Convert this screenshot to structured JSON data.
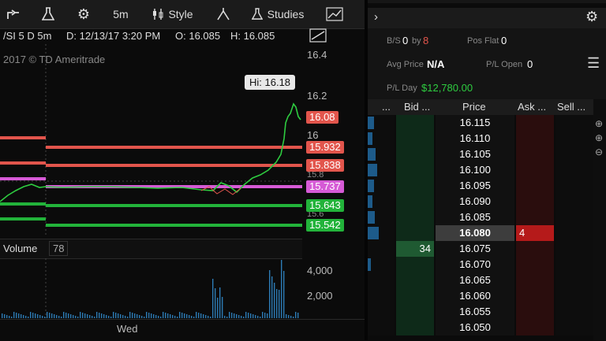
{
  "toolbar": {
    "timeframe": "5m",
    "style_label": "Style",
    "studies_label": "Studies"
  },
  "chart_header": {
    "symbol": "/SI 5 D 5m",
    "date": "D: 12/13/17 3:20 PM",
    "open": "O: 16.085",
    "high": "H: 16.085",
    "copyright": "2017 © TD Ameritrade"
  },
  "chart": {
    "hi_label": "Hi: 16.18",
    "y_ticks": [
      "16.4",
      "16.2",
      "16",
      "15.8",
      "15.6"
    ],
    "x_label": "Wed",
    "price_levels": [
      {
        "value": "16.08",
        "color": "#e2554c"
      },
      {
        "value": "15.932",
        "color": "#e2554c"
      },
      {
        "value": "15.838",
        "color": "#e2554c"
      },
      {
        "value": "15.737",
        "color": "#d65ad6"
      },
      {
        "value": "15.643",
        "color": "#22b33a"
      },
      {
        "value": "15.542",
        "color": "#22b33a"
      }
    ]
  },
  "volume": {
    "label": "Volume",
    "value": "78",
    "ticks": [
      "4,000",
      "2,000"
    ]
  },
  "account": {
    "bs_label": "B/S",
    "bs_value": "0",
    "by_label": "by",
    "by_value": "8",
    "pos_flat_label": "Pos Flat",
    "pos_flat_value": "0",
    "avg_price_label": "Avg Price",
    "avg_price_value": "N/A",
    "pl_open_label": "P/L Open",
    "pl_open_value": "0",
    "pl_day_label": "P/L Day",
    "pl_day_value": "$12,780.00"
  },
  "ladder": {
    "headers": [
      "...",
      "Bid ...",
      "Price",
      "Ask ...",
      "Sell ..."
    ],
    "rows": [
      {
        "price": "16.115",
        "bid": "",
        "ask": ""
      },
      {
        "price": "16.110",
        "bid": "",
        "ask": ""
      },
      {
        "price": "16.105",
        "bid": "",
        "ask": ""
      },
      {
        "price": "16.100",
        "bid": "",
        "ask": ""
      },
      {
        "price": "16.095",
        "bid": "",
        "ask": ""
      },
      {
        "price": "16.090",
        "bid": "",
        "ask": ""
      },
      {
        "price": "16.085",
        "bid": "",
        "ask": ""
      },
      {
        "price": "16.080",
        "bid": "",
        "ask": "4"
      },
      {
        "price": "16.075",
        "bid": "34",
        "ask": ""
      },
      {
        "price": "16.070",
        "bid": "",
        "ask": ""
      },
      {
        "price": "16.065",
        "bid": "",
        "ask": ""
      },
      {
        "price": "16.060",
        "bid": "",
        "ask": ""
      },
      {
        "price": "16.055",
        "bid": "",
        "ask": ""
      },
      {
        "price": "16.050",
        "bid": "",
        "ask": ""
      }
    ]
  },
  "colors": {
    "bid_bg": "#0e2a19",
    "ask_bg": "#2a0d0d",
    "ask_hit": "#b51a1a",
    "bid_hit": "#1f5a32",
    "last_price_bg": "#3d3d3d",
    "profit": "#2ecc40",
    "accent_blue": "#1d5b8a"
  }
}
